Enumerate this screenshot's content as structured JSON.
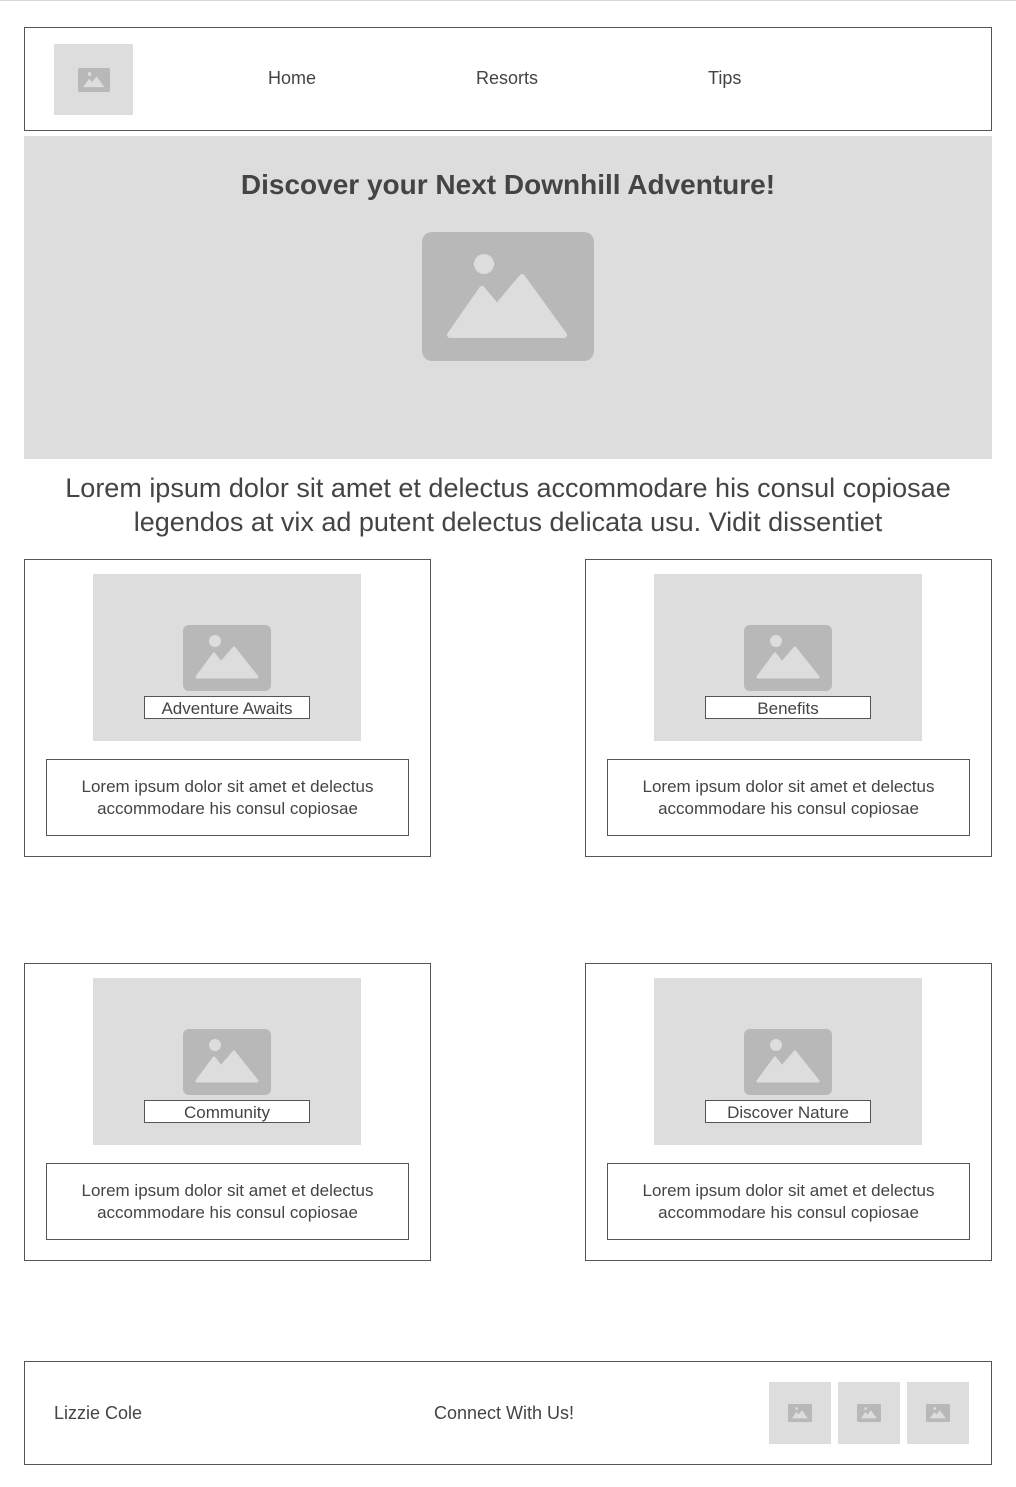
{
  "nav": {
    "logo_icon": "image-placeholder-icon",
    "links": [
      "Home",
      "Resorts",
      "Tips"
    ]
  },
  "hero": {
    "title": "Discover your Next Downhill Adventure!",
    "image_icon": "image-placeholder-icon"
  },
  "intro": "Lorem ipsum dolor sit amet et delectus accommodare his consul copiosae legendos at vix ad putent delectus delicata usu. Vidit dissentiet",
  "cards": [
    {
      "label": "Adventure Awaits",
      "text": "Lorem ipsum dolor sit amet et delectus accommodare his consul copiosae"
    },
    {
      "label": "Benefits",
      "text": "Lorem ipsum dolor sit amet et delectus accommodare his consul copiosae"
    },
    {
      "label": "Community",
      "text": "Lorem ipsum dolor sit amet et delectus accommodare his consul copiosae"
    },
    {
      "label": "Discover Nature",
      "text": "Lorem ipsum dolor sit amet et delectus accommodare his consul copiosae"
    }
  ],
  "footer": {
    "name": "Lizzie Cole",
    "connect": "Connect With Us!",
    "social_icons": [
      "image-placeholder-icon",
      "image-placeholder-icon",
      "image-placeholder-icon"
    ]
  },
  "colors": {
    "placeholder_bg": "#dddddd",
    "placeholder_icon": "#b8b8b8",
    "text": "#444444",
    "border": "#555555"
  }
}
